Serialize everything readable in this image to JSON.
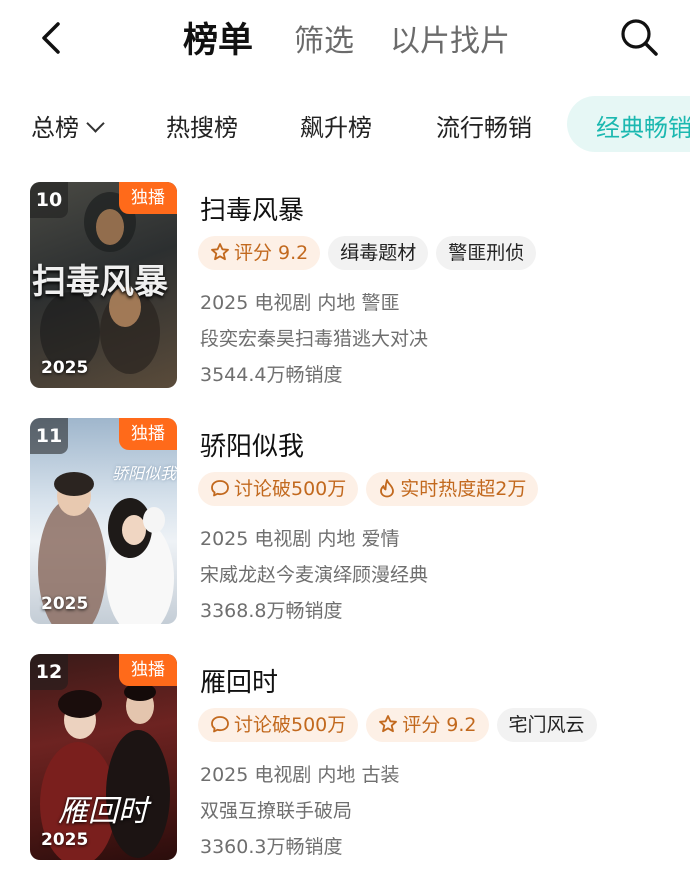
{
  "nav": {
    "tabs": [
      {
        "label": "榜单",
        "active": true
      },
      {
        "label": "筛选",
        "active": false
      },
      {
        "label": "以片找片",
        "active": false
      }
    ]
  },
  "categories": {
    "items": [
      "总榜",
      "热搜榜",
      "飙升榜",
      "流行畅销",
      "经典畅销"
    ],
    "active": "经典畅销",
    "accent": "#1bb8b0"
  },
  "list": [
    {
      "rank": "10",
      "badge": "独播",
      "poster_year": "2025",
      "poster_caption": "扫毒风暴",
      "title": "扫毒风暴",
      "tags": [
        {
          "icon": "star-icon",
          "text": "评分 9.2",
          "style": "hot"
        },
        {
          "text": "缉毒题材",
          "style": "plain"
        },
        {
          "text": "警匪刑侦",
          "style": "plain"
        }
      ],
      "meta": "2025 电视剧 内地 警匪",
      "desc": "段奕宏秦昊扫毒猎逃大对决",
      "sales": "3544.4万畅销度"
    },
    {
      "rank": "11",
      "badge": "独播",
      "poster_year": "2025",
      "poster_caption": "骄阳似我",
      "title": "骄阳似我",
      "tags": [
        {
          "icon": "comment-icon",
          "text": "讨论破500万",
          "style": "hot"
        },
        {
          "icon": "flame-icon",
          "text": "实时热度超2万",
          "style": "hot"
        }
      ],
      "meta": "2025 电视剧 内地 爱情",
      "desc": "宋威龙赵今麦演绎顾漫经典",
      "sales": "3368.8万畅销度"
    },
    {
      "rank": "12",
      "badge": "独播",
      "poster_year": "2025",
      "poster_caption": "雁回时",
      "title": "雁回时",
      "tags": [
        {
          "icon": "comment-icon",
          "text": "讨论破500万",
          "style": "hot"
        },
        {
          "icon": "star-icon",
          "text": "评分 9.2",
          "style": "hot"
        },
        {
          "text": "宅门风云",
          "style": "plain"
        }
      ],
      "meta": "2025 电视剧 内地 古装",
      "desc": "双强互撩联手破局",
      "sales": "3360.3万畅销度"
    }
  ],
  "colors": {
    "badge": "#ff6a1a",
    "tag_hot_bg": "#fdf0e6",
    "tag_hot_text": "#c2691e"
  }
}
